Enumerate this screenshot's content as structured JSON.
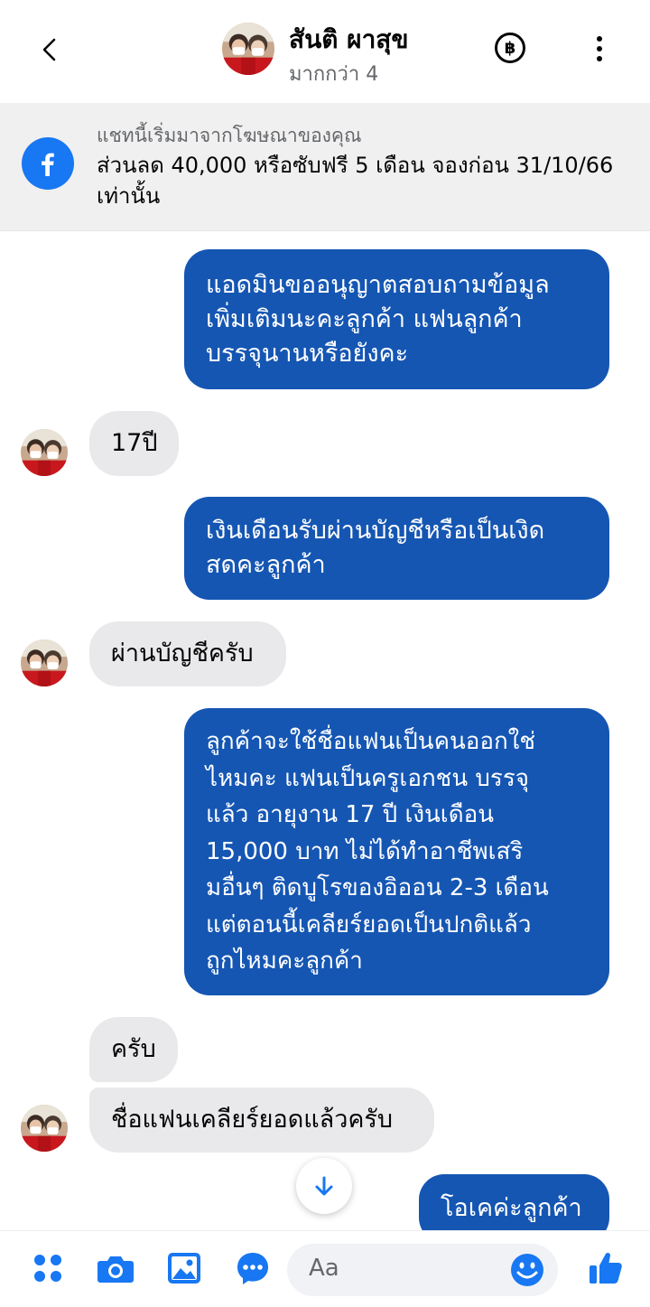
{
  "header": {
    "contact_name": "สันติ ผาสุข",
    "contact_sub": "มากกว่า 4",
    "currency_symbol": "฿"
  },
  "ad": {
    "label": "แชทนี้เริ่มมาจากโฆษณาของคุณ",
    "text": "ส่วนลด 40,000 หรือซับฟรี 5 เดือน จองก่อน 31/10/66 เท่านั้น"
  },
  "messages": [
    {
      "direction": "out",
      "text": "แอดมินขออนุญาตสอบถามข้อมูล\nเพิ่มเติมนะคะลูกค้า แฟนลูกค้า\nบรรจุนานหรือยังคะ"
    },
    {
      "direction": "in",
      "text": "17ปี"
    },
    {
      "direction": "out",
      "text": "เงินเดือนรับผ่านบัญชีหรือเป็นเงิด\nสดคะลูกค้า"
    },
    {
      "direction": "in",
      "text": "ผ่านบัญชีครับ"
    },
    {
      "direction": "out",
      "text": "ลูกค้าจะใช้ชื่อแฟนเป็นคนออกใช่\nไหมคะ แฟนเป็นครูเอกชน บรรจุ\nแล้ว อายุงาน 17 ปี เงินเดือน\n15,000 บาท ไม่ได้ทำอาชีพเสริ\nมอื่นๆ ติดบูโรของอิออน 2-3 เดือน\nแต่ตอนนี้เคลียร์ยอดเป็นปกติแล้ว\nถูกไหมคะลูกค้า"
    },
    {
      "direction": "in",
      "text": "ครับ"
    },
    {
      "direction": "in",
      "text": "ชื่อแฟนเคลียร์ยอดแล้วครับ"
    },
    {
      "direction": "out",
      "text": "โอเคค่ะลูกค้า"
    }
  ],
  "composer": {
    "placeholder": "Aa"
  },
  "colors": {
    "outgoing_bubble": "#1556b3",
    "incoming_bubble": "#e9e9eb",
    "accent": "#1877f2",
    "banner_bg": "#f0f0f0"
  },
  "icons": [
    "back-arrow-icon",
    "baht-icon",
    "more-vertical-icon",
    "facebook-icon",
    "arrow-down-icon",
    "apps-icon",
    "camera-icon",
    "image-icon",
    "chat-bubble-icon",
    "emoji-icon",
    "like-thumb-icon"
  ]
}
